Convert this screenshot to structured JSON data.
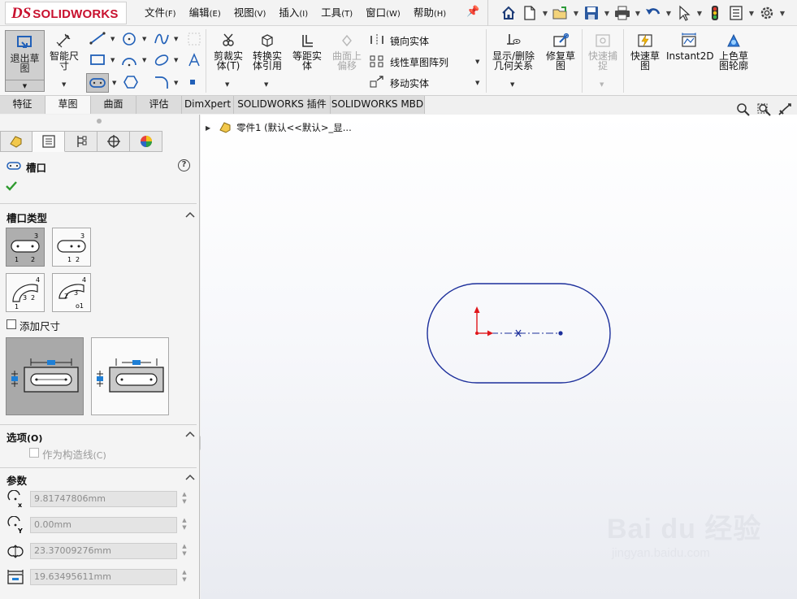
{
  "app": {
    "logo_ds": "DS",
    "logo_text": "SOLIDWORKS"
  },
  "menu": [
    {
      "label": "文件",
      "acc": "(F)"
    },
    {
      "label": "编辑",
      "acc": "(E)"
    },
    {
      "label": "视图",
      "acc": "(V)"
    },
    {
      "label": "插入",
      "acc": "(I)"
    },
    {
      "label": "工具",
      "acc": "(T)"
    },
    {
      "label": "窗口",
      "acc": "(W)"
    },
    {
      "label": "帮助",
      "acc": "(H)"
    }
  ],
  "quick_icons": [
    "home-icon",
    "new-document-icon",
    "open-folder-icon",
    "save-icon",
    "print-icon",
    "undo-icon",
    "select-cursor-icon",
    "rebuild-traffic-light-icon",
    "file-properties-icon",
    "options-gear-icon"
  ],
  "ribbon": {
    "exit_sketch_line1": "退出草",
    "exit_sketch_line2": "图",
    "smart_dim_line1": "智能尺",
    "smart_dim_line2": "寸",
    "trim_line1": "剪裁实",
    "trim_line2": "体(T)",
    "convert_line1": "转换实",
    "convert_line2": "体引用",
    "offset_line1": "等距实",
    "offset_line2": "体",
    "surface_offset_line1": "曲面上",
    "surface_offset_line2": "偏移",
    "mirror": "镜向实体",
    "linear_pattern": "线性草图阵列",
    "move": "移动实体",
    "relations_line1": "显示/删除",
    "relations_line2": "几何关系",
    "repair_line1": "修复草",
    "repair_line2": "图",
    "quick_snaps_line1": "快速捕",
    "quick_snaps_line2": "捉",
    "rapid_line1": "快速草",
    "rapid_line2": "图",
    "instant2d": "Instant2D",
    "shaded_line1": "上色草",
    "shaded_line2": "图轮廓"
  },
  "tabs": [
    "特征",
    "草图",
    "曲面",
    "评估",
    "DimXpert",
    "SOLIDWORKS 插件",
    "SOLIDWORKS MBD"
  ],
  "active_tab": "草图",
  "panel": {
    "title": "槽口",
    "slot_type_header": "槽口类型",
    "add_dims_label": "添加尺寸",
    "options_header": "选项",
    "options_acc": "(O)",
    "construction_label": "作为构造线",
    "construction_acc": "(C)",
    "params_header": "参数",
    "params": [
      {
        "value": "9.81747806mm"
      },
      {
        "value": "0.00mm"
      },
      {
        "value": "23.37009276mm"
      },
      {
        "value": "19.63495611mm"
      }
    ]
  },
  "graphics": {
    "tree_label": "零件1  (默认<<默认>_显...",
    "watermark_main": "Bai du 经验",
    "watermark_sub": "jingyan.baidu.com"
  },
  "colors": {
    "accent_red": "#c8102e",
    "sketch_blue": "#1c2f9b",
    "origin_red": "#e0161b"
  }
}
